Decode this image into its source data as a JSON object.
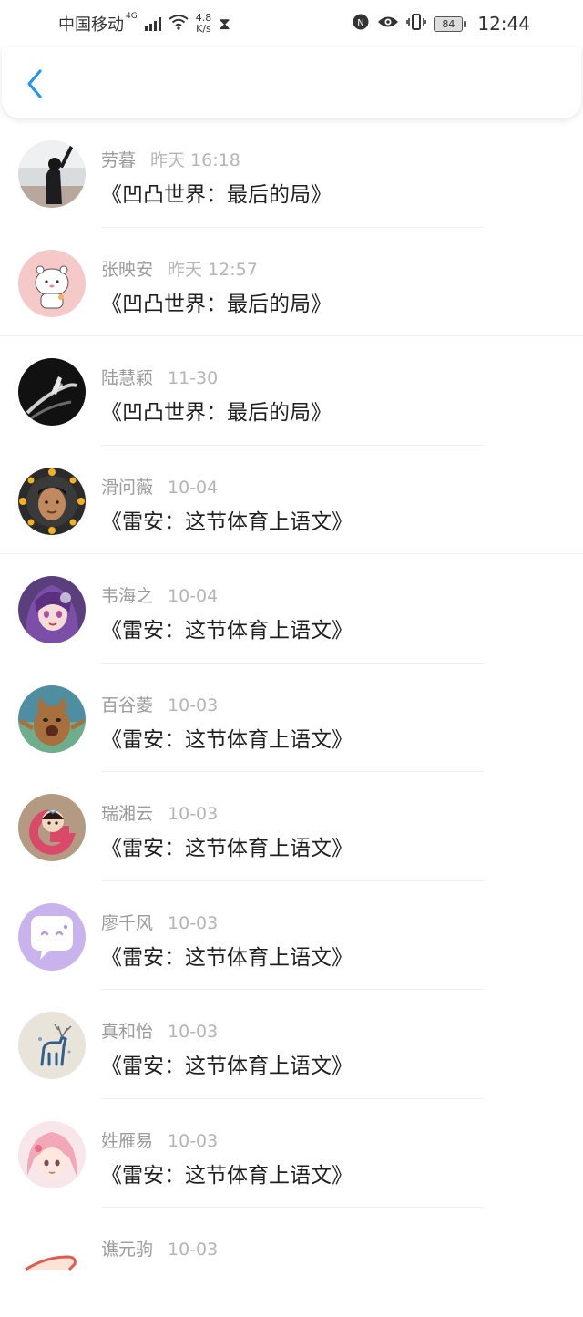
{
  "status_bar": {
    "carrier": "中国移动",
    "network": "4G",
    "speed_value": "4.8",
    "speed_unit": "K/s",
    "battery": "84",
    "time": "12:44"
  },
  "header": {
    "back_icon": "chevron-left-icon",
    "accent_color": "#2196f3"
  },
  "messages": [
    {
      "name": "劳暮",
      "time": "昨天 16:18",
      "text": "《凹凸世界：最后的局》"
    },
    {
      "name": "张映安",
      "time": "昨天 12:57",
      "text": "《凹凸世界：最后的局》"
    },
    {
      "name": "陆慧颖",
      "time": "11-30",
      "text": "《凹凸世界：最后的局》"
    },
    {
      "name": "滑问薇",
      "time": "10-04",
      "text": "《雷安：这节体育上语文》"
    },
    {
      "name": "韦海之",
      "time": "10-04",
      "text": "《雷安：这节体育上语文》"
    },
    {
      "name": "百谷菱",
      "time": "10-03",
      "text": "《雷安：这节体育上语文》"
    },
    {
      "name": "瑞湘云",
      "time": "10-03",
      "text": "《雷安：这节体育上语文》"
    },
    {
      "name": "廖千风",
      "time": "10-03",
      "text": "《雷安：这节体育上语文》"
    },
    {
      "name": "真和怡",
      "time": "10-03",
      "text": "《雷安：这节体育上语文》"
    },
    {
      "name": "姓雁易",
      "time": "10-03",
      "text": "《雷安：这节体育上语文》"
    },
    {
      "name": "谯元驹",
      "time": "10-03",
      "text": ""
    }
  ]
}
